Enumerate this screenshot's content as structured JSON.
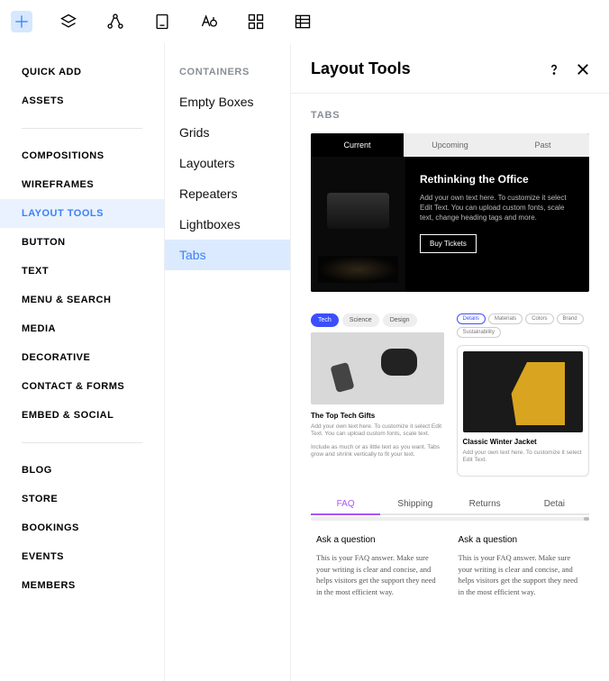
{
  "panelTitle": "Layout Tools",
  "sectionLabel": "TABS",
  "sidebar": {
    "groups": [
      [
        "QUICK ADD",
        "ASSETS"
      ],
      [
        "COMPOSITIONS",
        "WIREFRAMES",
        "LAYOUT TOOLS",
        "BUTTON",
        "TEXT",
        "MENU & SEARCH",
        "MEDIA",
        "DECORATIVE",
        "CONTACT & FORMS",
        "EMBED & SOCIAL"
      ],
      [
        "BLOG",
        "STORE",
        "BOOKINGS",
        "EVENTS",
        "MEMBERS"
      ]
    ],
    "activeIndex": "LAYOUT TOOLS"
  },
  "containers": {
    "heading": "CONTAINERS",
    "items": [
      "Empty Boxes",
      "Grids",
      "Layouters",
      "Repeaters",
      "Lightboxes",
      "Tabs"
    ],
    "active": "Tabs"
  },
  "preview1": {
    "tabs": [
      "Current",
      "Upcoming",
      "Past"
    ],
    "title": "Rethinking the Office",
    "desc": "Add your own text here. To customize it select Edit Text. You can upload custom fonts, scale text, change heading tags and more.",
    "button": "Buy Tickets"
  },
  "preview2": {
    "tabs": [
      "Tech",
      "Science",
      "Design"
    ],
    "title": "The Top Tech Gifts",
    "desc1": "Add your own text here. To customize it select Edit Text. You can upload custom fonts, scale text.",
    "desc2": "Include as much or as little text as you want. Tabs grow and shrink vertically to fit your text."
  },
  "preview3": {
    "tags": [
      "Details",
      "Materials",
      "Colors",
      "Brand",
      "Sustainability"
    ],
    "title": "Classic Winter Jacket",
    "desc": "Add your own text here. To customize it select Edit Text."
  },
  "preview4": {
    "tabs": [
      "FAQ",
      "Shipping",
      "Returns",
      "Detai"
    ],
    "q": "Ask a question",
    "a": "This is your FAQ answer. Make sure your writing is clear and concise, and helps visitors get the support they need in the most efficient way."
  }
}
